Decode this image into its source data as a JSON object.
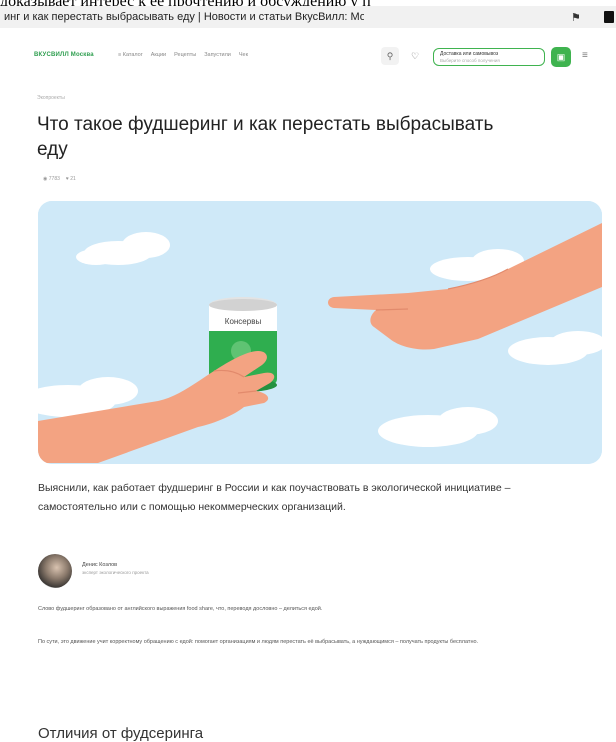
{
  "overline": {
    "text": "доказывает интерес к ее прочтению и обсуждению у п"
  },
  "browser": {
    "tab_title": "инг и как перестать выбрасывать еду | Новости и статьи ВкусВилл: Москв...",
    "bookmark_icon": "bookmark-icon",
    "extension_icon": "extension-icon"
  },
  "header": {
    "logo": "ВКУСВИЛЛ Москва",
    "nav": [
      "≡ Каталог",
      "Акции",
      "Рецепты",
      "Запустили",
      "Чек"
    ],
    "delivery_line1": "Доставка или самовывоз",
    "delivery_line2": "Выберите способ получения",
    "icons": [
      "search-icon",
      "favorites-icon",
      "cart-icon",
      "menu-icon"
    ]
  },
  "article": {
    "breadcrumb": "Экопроекты",
    "title": "Что такое фудшеринг и как перестать выбрасывать еду",
    "meta_views": "◉ 7783",
    "meta_likes": "♥ 21",
    "can_label": "Консервы",
    "lede": "Выяснили, как работает фудшеринг в России и как поучаствовать в экологической инициативе – самостоятельно или с помощью некоммерческих организаций.",
    "author_name": "Денис Козлов",
    "author_role": "эксперт экологического проекта",
    "paragraph_1": "Слово фудшеринг образовано от английского выражения food share, что, переводя дословно – делиться едой.",
    "paragraph_2": "По сути, это движение учит корректному обращению с едой: помогает организациям и людям перестать её выбрасывать, а нуждающимся – получать продукты бесплатно.",
    "next_heading": "Отличия от фудсеринга"
  },
  "colors": {
    "brand_green": "#3fb34f",
    "sky": "#cfe9f8",
    "skin": "#f3a382"
  }
}
